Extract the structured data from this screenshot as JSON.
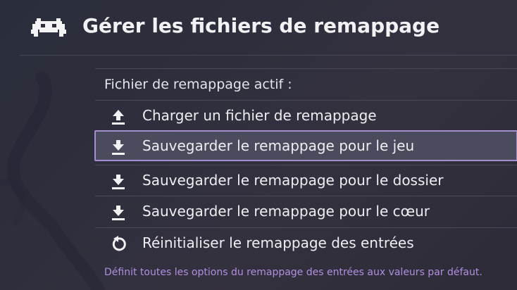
{
  "header": {
    "logo_icon": "retroarch-invader-icon",
    "title": "Gérer les fichiers de remappage"
  },
  "menu": {
    "heading": "Fichier de remappage actif :",
    "selected_index": 1,
    "items": [
      {
        "label": "Charger un fichier de remappage",
        "icon": "upload-icon"
      },
      {
        "label": "Sauvegarder le remappage pour le jeu",
        "icon": "download-icon"
      },
      {
        "label": "Sauvegarder le remappage pour le dossier",
        "icon": "download-icon"
      },
      {
        "label": "Sauvegarder le remappage pour le cœur",
        "icon": "download-icon"
      },
      {
        "label": "Réinitialiser le remappage des entrées",
        "icon": "reset-icon"
      }
    ]
  },
  "footer": {
    "description": "Définit toutes les options du remappage des entrées aux valeurs par défaut."
  },
  "colors": {
    "selection_border": "#a58fd1",
    "description_text": "#b08fe0",
    "background": "#2e2f3d"
  }
}
